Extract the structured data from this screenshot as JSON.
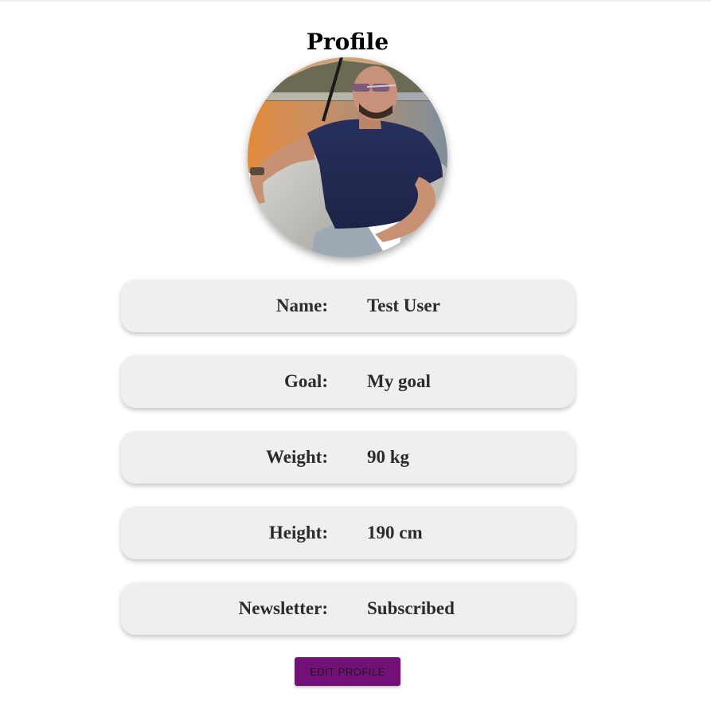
{
  "page": {
    "title": "Profile"
  },
  "avatar": {
    "alt": "Profile photo",
    "icon": "profile-photo"
  },
  "fields": [
    {
      "label": "Name:",
      "value": "Test User"
    },
    {
      "label": "Goal:",
      "value": "My goal"
    },
    {
      "label": "Weight:",
      "value": "90 kg"
    },
    {
      "label": "Height:",
      "value": "190 cm"
    },
    {
      "label": "Newsletter:",
      "value": "Subscribed"
    }
  ],
  "actions": {
    "edit_label": "EDIT PROFILE"
  },
  "colors": {
    "row_background": "#efefef",
    "button_background": "#731078",
    "text": "#2b2b2b"
  }
}
